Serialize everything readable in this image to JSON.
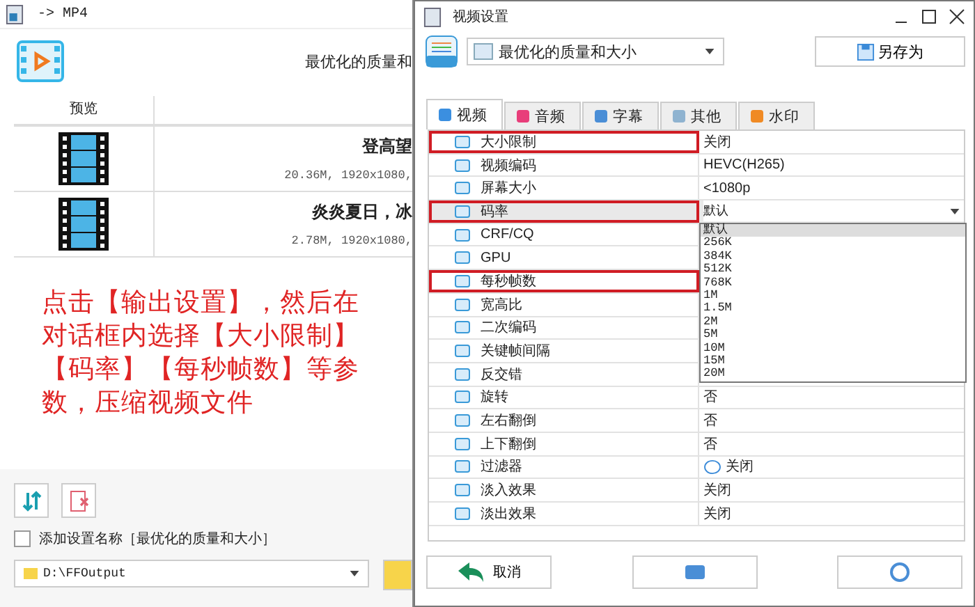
{
  "main_window": {
    "title": "-> MP4",
    "header_text": "最优化的质量和",
    "table": {
      "columns": [
        "预览"
      ],
      "rows": [
        {
          "title": "登高望",
          "info": "20.36M, 1920x1080,"
        },
        {
          "title": "炎炎夏日，冰",
          "info": "2.78M, 1920x1080,"
        }
      ]
    },
    "annotation": "点击【输出设置】，然后在对话框内选择【大小限制】【码率】【每秒帧数】等参数，压缩视频文件",
    "add_name": {
      "label": "添加设置名称［最优化的质量和大小］",
      "checked": false
    },
    "output_folder": "D:\\FFOutput"
  },
  "dialog": {
    "title": "视频设置",
    "preset": "最优化的质量和大小",
    "save_as": "另存为",
    "tabs": [
      {
        "label": "视频",
        "selected": true,
        "color": "#3b8fe0"
      },
      {
        "label": "音频",
        "selected": false,
        "color": "#e83e7a"
      },
      {
        "label": "字幕",
        "selected": false,
        "color": "#4a8ed6"
      },
      {
        "label": "其他",
        "selected": false,
        "color": "#8fb3d0"
      },
      {
        "label": "水印",
        "selected": false,
        "color": "#f08a24"
      }
    ],
    "properties": [
      {
        "name": "大小限制",
        "value": "关闭",
        "kind": "text",
        "highlighted": true,
        "selected": false
      },
      {
        "name": "视频编码",
        "value": "HEVC(H265)",
        "kind": "text",
        "highlighted": false,
        "selected": false
      },
      {
        "name": "屏幕大小",
        "value": "<1080p",
        "kind": "text",
        "highlighted": false,
        "selected": false
      },
      {
        "name": "码率",
        "value": "默认",
        "kind": "dropdown",
        "highlighted": true,
        "selected": true
      },
      {
        "name": "CRF/CQ",
        "highlighted": false,
        "selected": false
      },
      {
        "name": "GPU",
        "highlighted": false,
        "selected": false
      },
      {
        "name": "每秒帧数",
        "highlighted": true,
        "selected": false
      },
      {
        "name": "宽高比",
        "highlighted": false,
        "selected": false
      },
      {
        "name": "二次编码",
        "highlighted": false,
        "selected": false
      },
      {
        "name": "关键帧间隔",
        "highlighted": false,
        "selected": false
      },
      {
        "name": "反交错",
        "highlighted": false,
        "selected": false
      },
      {
        "name": "旋转",
        "value": "否",
        "kind": "text",
        "highlighted": false,
        "selected": false
      },
      {
        "name": "左右翻倒",
        "value": "否",
        "kind": "text",
        "highlighted": false,
        "selected": false
      },
      {
        "name": "上下翻倒",
        "value": "否",
        "kind": "text",
        "highlighted": false,
        "selected": false
      },
      {
        "name": "过滤器",
        "value": "关闭",
        "kind": "toggle",
        "highlighted": false,
        "selected": false
      },
      {
        "name": "淡入效果",
        "value": "关闭",
        "kind": "text",
        "highlighted": false,
        "selected": false
      },
      {
        "name": "淡出效果",
        "value": "关闭",
        "kind": "text",
        "highlighted": false,
        "selected": false
      }
    ],
    "dropdown_items": [
      {
        "label": "默认",
        "selected": true
      },
      {
        "label": "256K",
        "selected": false
      },
      {
        "label": "384K",
        "selected": false
      },
      {
        "label": "512K",
        "selected": false
      },
      {
        "label": "768K",
        "selected": false
      },
      {
        "label": "1M",
        "selected": false
      },
      {
        "label": "1.5M",
        "selected": false
      },
      {
        "label": "2M",
        "selected": false
      },
      {
        "label": "5M",
        "selected": false
      },
      {
        "label": "10M",
        "selected": false
      },
      {
        "label": "15M",
        "selected": false
      },
      {
        "label": "20M",
        "selected": false
      }
    ],
    "buttons": [
      {
        "label": "取消",
        "kind": "cancel"
      },
      {
        "kind": "ok"
      },
      {
        "kind": "help"
      }
    ]
  }
}
